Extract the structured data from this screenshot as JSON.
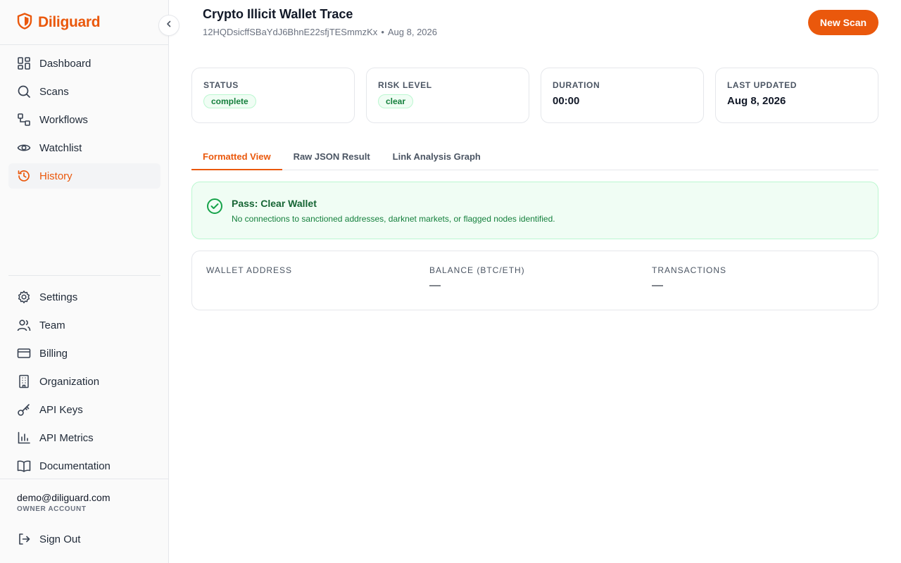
{
  "app": {
    "name": "Diliguard",
    "brand_color": "#ea580c"
  },
  "sidebar": {
    "main_items": [
      {
        "label": "Dashboard",
        "icon": "dashboard-icon"
      },
      {
        "label": "Scans",
        "icon": "search-icon"
      },
      {
        "label": "Workflows",
        "icon": "workflow-icon"
      },
      {
        "label": "Watchlist",
        "icon": "eye-icon"
      },
      {
        "label": "History",
        "icon": "history-icon",
        "active": true
      }
    ],
    "settings_items": [
      {
        "label": "Settings",
        "icon": "gear-icon"
      },
      {
        "label": "Team",
        "icon": "users-icon"
      },
      {
        "label": "Billing",
        "icon": "credit-card-icon"
      },
      {
        "label": "Organization",
        "icon": "building-icon"
      },
      {
        "label": "API Keys",
        "icon": "key-icon"
      },
      {
        "label": "API Metrics",
        "icon": "bar-chart-icon"
      },
      {
        "label": "Documentation",
        "icon": "book-icon"
      }
    ],
    "user": {
      "email": "demo@diliguard.com",
      "role": "OWNER ACCOUNT"
    },
    "sign_out": "Sign Out"
  },
  "header": {
    "title": "Crypto Illicit Wallet Trace",
    "wallet_id": "12HQDsicffSBaYdJ6BhnE22sfjTESmmzKx",
    "separator": "•",
    "date": "Aug 8, 2026",
    "new_scan_label": "New Scan"
  },
  "stats": {
    "status": {
      "label": "STATUS",
      "value": "complete"
    },
    "risk": {
      "label": "RISK LEVEL",
      "value": "clear"
    },
    "duration": {
      "label": "DURATION",
      "value": "00:00"
    },
    "updated": {
      "label": "LAST UPDATED",
      "value": "Aug 8, 2026"
    }
  },
  "tabs": [
    {
      "label": "Formatted View",
      "active": true
    },
    {
      "label": "Raw JSON Result"
    },
    {
      "label": "Link Analysis Graph"
    }
  ],
  "result": {
    "title": "Pass: Clear Wallet",
    "description": "No connections to sanctioned addresses, darknet markets, or flagged nodes identified."
  },
  "details": {
    "wallet_address": {
      "label": "WALLET ADDRESS",
      "value": ""
    },
    "balance": {
      "label": "BALANCE (BTC/ETH)",
      "value": "—"
    },
    "transactions": {
      "label": "TRANSACTIONS",
      "value": "—"
    }
  }
}
